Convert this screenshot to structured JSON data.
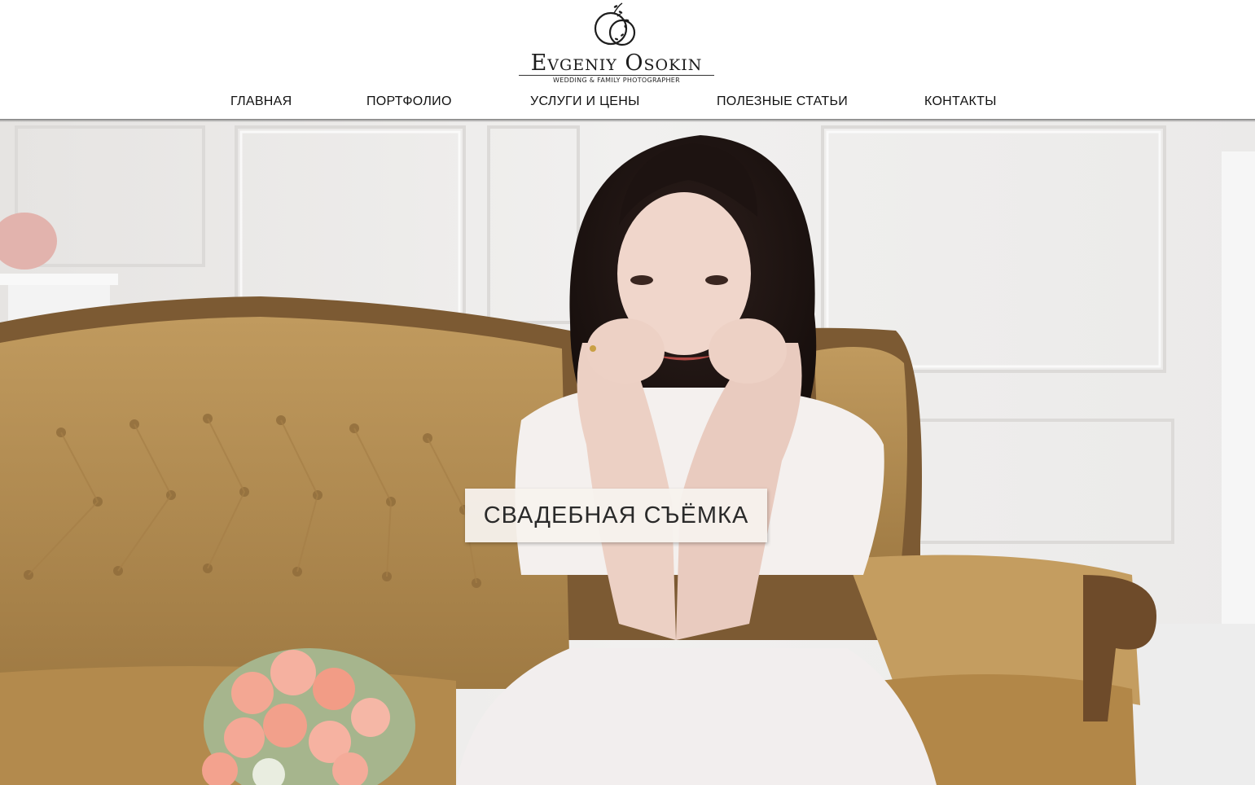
{
  "header": {
    "logo": {
      "name": "Evgeniy Osokin",
      "tagline": "WEDDING & FAMILY PHOTOGRAPHER"
    },
    "nav": [
      {
        "label": "ГЛАВНАЯ"
      },
      {
        "label": "ПОРТФОЛИО"
      },
      {
        "label": "УСЛУГИ И ЦЕНЫ"
      },
      {
        "label": "ПОЛЕЗНЫЕ СТАТЬИ"
      },
      {
        "label": "КОНТАКТЫ"
      }
    ]
  },
  "hero": {
    "caption": "СВАДЕБНАЯ СЪЁМКА"
  },
  "colors": {
    "header_bg": "#ffffff",
    "text": "#111111",
    "sofa": "#b98f52",
    "wall": "#ecebea",
    "caption_bg": "#f6f2ee"
  },
  "icons": [
    "rings-logo-icon"
  ]
}
